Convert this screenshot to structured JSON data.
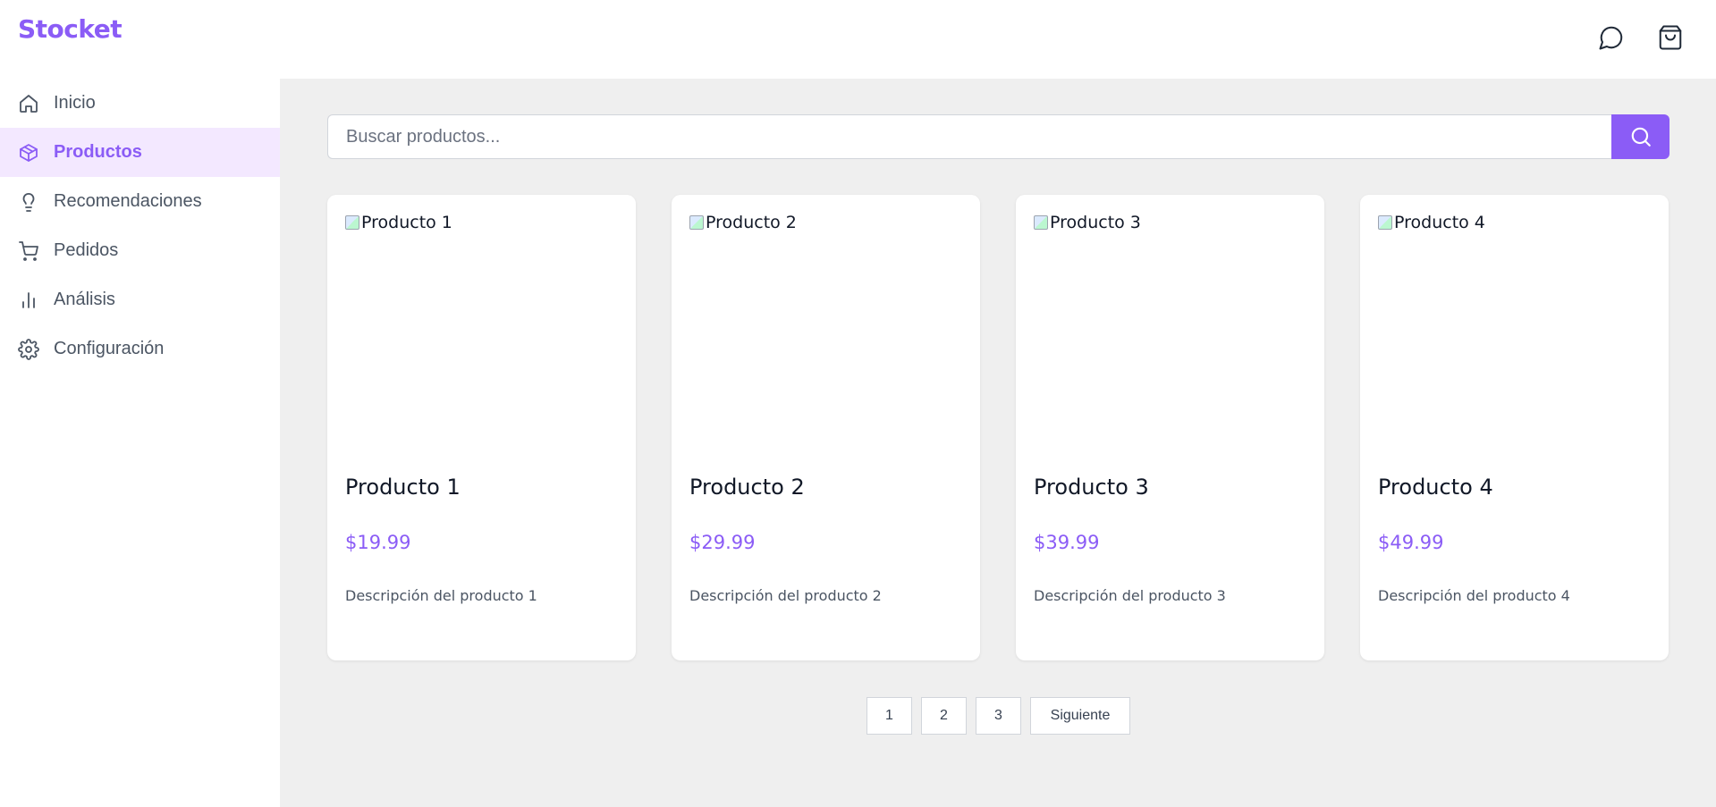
{
  "app": {
    "logo": "Stocket"
  },
  "header": {
    "icons": [
      "chat-bubble-icon",
      "shopping-bag-icon"
    ]
  },
  "sidebar": {
    "items": [
      {
        "label": "Inicio",
        "icon": "home-icon",
        "active": false
      },
      {
        "label": "Productos",
        "icon": "box-icon",
        "active": true
      },
      {
        "label": "Recomendaciones",
        "icon": "lightbulb-icon",
        "active": false
      },
      {
        "label": "Pedidos",
        "icon": "cart-icon",
        "active": false
      },
      {
        "label": "Análisis",
        "icon": "bar-chart-icon",
        "active": false
      },
      {
        "label": "Configuración",
        "icon": "gear-icon",
        "active": false
      }
    ]
  },
  "search": {
    "placeholder": "Buscar productos...",
    "value": "",
    "button_icon": "search-icon"
  },
  "products": [
    {
      "image_alt": "Producto 1",
      "name": "Producto 1",
      "price": "$19.99",
      "description": "Descripción del producto 1"
    },
    {
      "image_alt": "Producto 2",
      "name": "Producto 2",
      "price": "$29.99",
      "description": "Descripción del producto 2"
    },
    {
      "image_alt": "Producto 3",
      "name": "Producto 3",
      "price": "$39.99",
      "description": "Descripción del producto 3"
    },
    {
      "image_alt": "Producto 4",
      "name": "Producto 4",
      "price": "$49.99",
      "description": "Descripción del producto 4"
    }
  ],
  "pagination": {
    "pages": [
      "1",
      "2",
      "3"
    ],
    "next_label": "Siguiente"
  },
  "colors": {
    "accent": "#8b5cf6",
    "active_bg": "#f3e8ff",
    "main_bg": "#efefef"
  }
}
